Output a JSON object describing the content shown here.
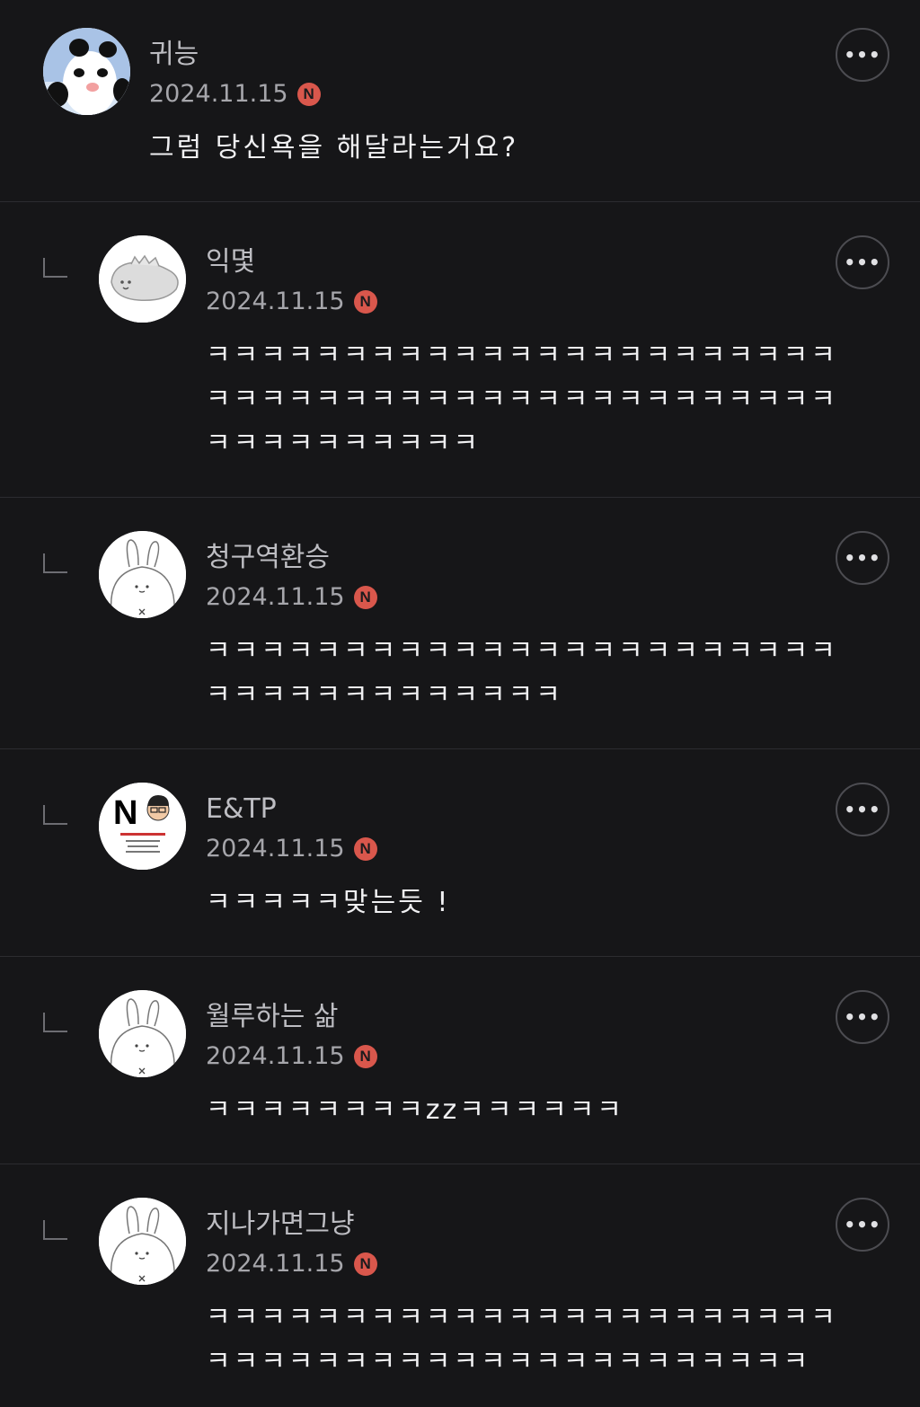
{
  "comments": [
    {
      "author": "귀능",
      "date": "2024.11.15",
      "badge": "N",
      "text": "그럼 당신욕을 해달라는거요?",
      "more_label": "•••",
      "avatar_icon": "panda-avatar"
    },
    {
      "author": "익몇",
      "date": "2024.11.15",
      "badge": "N",
      "text": "ㅋㅋㅋㅋㅋㅋㅋㅋㅋㅋㅋㅋㅋㅋㅋㅋㅋㅋㅋㅋㅋㅋㅋ\nㅋㅋㅋㅋㅋㅋㅋㅋㅋㅋㅋㅋㅋㅋㅋㅋㅋㅋㅋㅋㅋㅋㅋ\nㅋㅋㅋㅋㅋㅋㅋㅋㅋㅋ",
      "more_label": "•••",
      "avatar_icon": "dinosaur-avatar"
    },
    {
      "author": "청구역환승",
      "date": "2024.11.15",
      "badge": "N",
      "text": "ㅋㅋㅋㅋㅋㅋㅋㅋㅋㅋㅋㅋㅋㅋㅋㅋㅋㅋㅋㅋㅋㅋㅋ\nㅋㅋㅋㅋㅋㅋㅋㅋㅋㅋㅋㅋㅋ",
      "more_label": "•••",
      "avatar_icon": "bunny-avatar"
    },
    {
      "author": "E&TP",
      "date": "2024.11.15",
      "badge": "N",
      "text": "ㅋㅋㅋㅋㅋ맞는듯 !",
      "more_label": "•••",
      "avatar_icon": "boycott-logo-avatar",
      "avatar_letter": "N"
    },
    {
      "author": "월루하는 삶",
      "date": "2024.11.15",
      "badge": "N",
      "text": "ㅋㅋㅋㅋㅋㅋㅋㅋzzㅋㅋㅋㅋㅋㅋ",
      "more_label": "•••",
      "avatar_icon": "bunny-avatar"
    },
    {
      "author": "지나가면그냥",
      "date": "2024.11.15",
      "badge": "N",
      "text": "ㅋㅋㅋㅋㅋㅋㅋㅋㅋㅋㅋㅋㅋㅋㅋㅋㅋㅋㅋㅋㅋㅋㅋ\nㅋㅋㅋㅋㅋㅋㅋㅋㅋㅋㅋㅋㅋㅋㅋㅋㅋㅋㅋㅋㅋㅋ",
      "more_label": "•••",
      "avatar_icon": "bunny-avatar"
    }
  ],
  "colors": {
    "background": "#161618",
    "badge": "#d9574c",
    "divider": "#2c2c30"
  }
}
